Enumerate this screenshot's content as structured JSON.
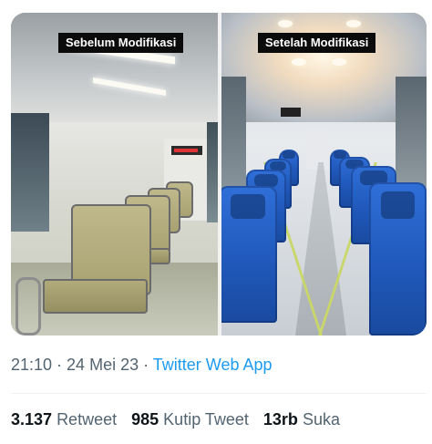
{
  "media": {
    "before_label": "Sebelum Modifikasi",
    "after_label": "Setelah Modifikasi"
  },
  "meta": {
    "time": "21:10",
    "dot1": " · ",
    "date": "24 Mei 23",
    "dot2": " · ",
    "source": "Twitter Web App"
  },
  "stats": {
    "retweet_count": "3.137",
    "retweet_label": "Retweet",
    "quote_count": "985",
    "quote_label": "Kutip Tweet",
    "like_count": "13rb",
    "like_label": "Suka"
  },
  "colors": {
    "link": "#1d9bf0",
    "muted": "#536471",
    "seat_before": "#bfb88b",
    "seat_after": "#1f57b8"
  }
}
